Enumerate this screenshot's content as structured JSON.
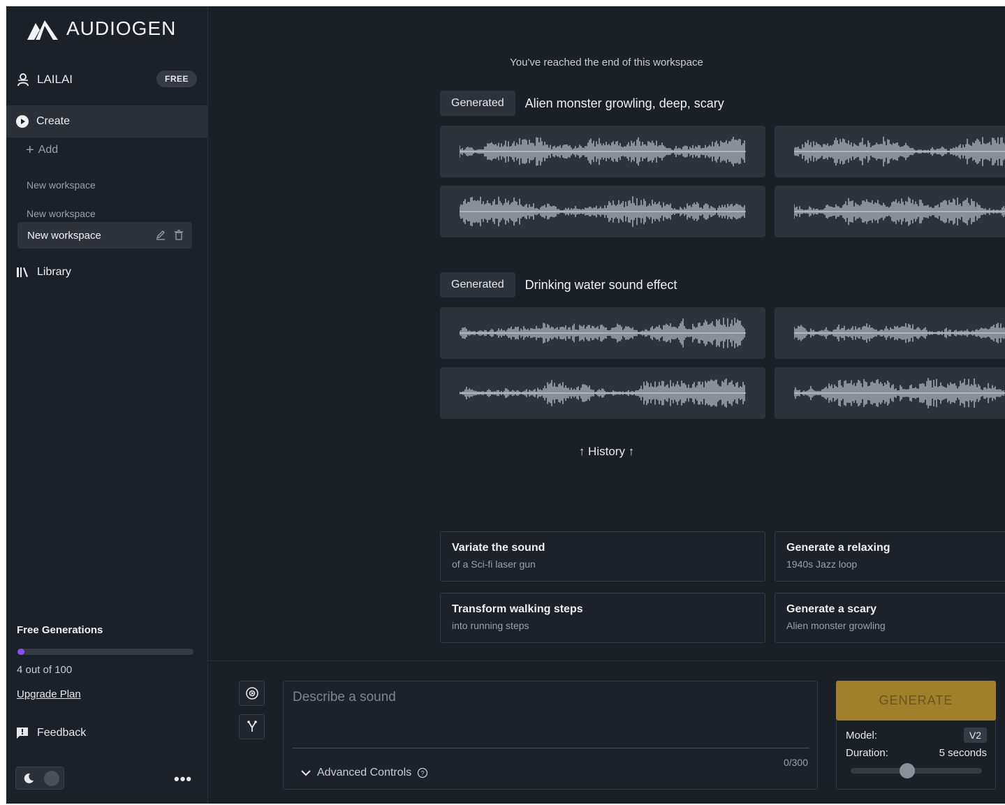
{
  "brand": {
    "name": "AUDIOGEN"
  },
  "user": {
    "name": "LAILAI",
    "plan": "FREE"
  },
  "nav": {
    "create": "Create",
    "add": "Add",
    "workspaces": [
      "New workspace",
      "New workspace",
      "New workspace"
    ],
    "library": "Library"
  },
  "usage": {
    "title": "Free Generations",
    "used": 4,
    "total": 100,
    "count_text": "4 out of 100",
    "upgrade": "Upgrade Plan"
  },
  "feedback": "Feedback",
  "main": {
    "end_notice": "You've reached the end of this workspace",
    "history": "↑ History ↑",
    "generations": [
      {
        "tag": "Generated",
        "prompt": "Alien monster growling, deep, scary"
      },
      {
        "tag": "Generated",
        "prompt": "Drinking water sound effect"
      }
    ],
    "suggestions": [
      {
        "title": "Variate the sound",
        "subtitle": "of a Sci-fi laser gun"
      },
      {
        "title": "Generate a relaxing",
        "subtitle": "1940s Jazz loop"
      },
      {
        "title": "Transform walking steps",
        "subtitle": "into running steps"
      },
      {
        "title": "Generate a scary",
        "subtitle": "Alien monster growling"
      }
    ]
  },
  "composer": {
    "placeholder": "Describe a sound",
    "char_count": "0/300",
    "advanced": "Advanced Controls",
    "generate": "GENERATE",
    "model_label": "Model:",
    "model_value": "V2",
    "duration_label": "Duration:",
    "duration_value": "5 seconds",
    "duration_slider_fraction": 0.43
  },
  "colors": {
    "background": "#1b1f26",
    "card": "#2d323b",
    "accent_gold": "#a17f2b",
    "progress_purple": "#8a4ef3"
  }
}
